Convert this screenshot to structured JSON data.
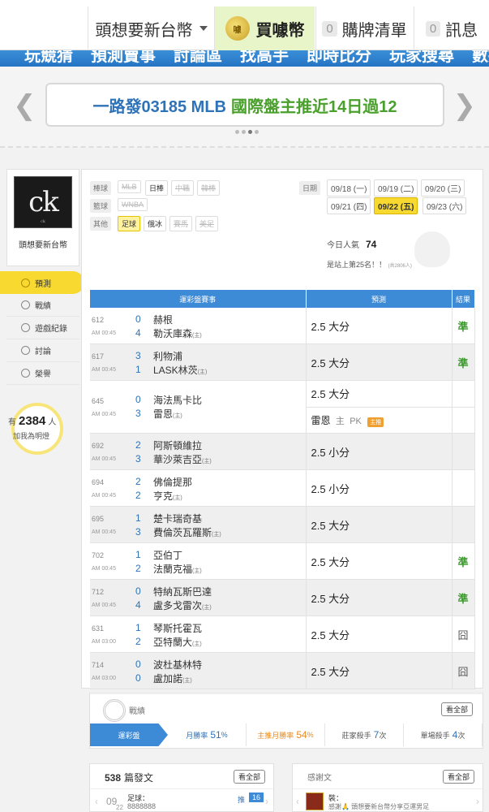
{
  "topbar": {
    "username": "頭想要新台幣",
    "buy_label": "買噱幣",
    "coin_glyph": "噱",
    "bets_count": "0",
    "bets_label": "購牌清單",
    "msg_count": "0",
    "msg_label": "訊息"
  },
  "nav": {
    "items": [
      "玩競猜",
      "預測賣事",
      "討論區",
      "找高手",
      "即時比分",
      "玩家搜尋",
      "數據"
    ]
  },
  "banner": {
    "prefix": "一路發03185 MLB",
    "highlight": "國際盤主推近14日過12",
    "prev_glyph": "❮",
    "next_glyph": "❯"
  },
  "sidebar": {
    "avatar_text": "ck",
    "avatar_sub": "ck",
    "username": "頭想要新台幣",
    "menu": [
      {
        "label": "預測",
        "icon": "target-icon",
        "active": true
      },
      {
        "label": "戰績",
        "icon": "record-icon"
      },
      {
        "label": "遊戲紀錄",
        "icon": "history-icon"
      },
      {
        "label": "討論",
        "icon": "discussion-icon"
      },
      {
        "label": "榮譽",
        "icon": "honor-icon"
      }
    ],
    "fans_prefix": "有",
    "fans_count": "2384",
    "fans_suffix": "人",
    "fans_note": "加我為明燈"
  },
  "filters": {
    "baseball_label": "棒球",
    "basketball_label": "籃球",
    "other_label": "其他",
    "baseball": [
      "MLB",
      "日棒",
      "中職",
      "韓棒"
    ],
    "basketball": [
      "WNBA"
    ],
    "other": [
      "足球",
      "俄冰",
      "賽馬",
      "美足"
    ],
    "date_label": "日期",
    "dates": [
      "09/18 (一)",
      "09/19 (二)",
      "09/20 (三)",
      "09/21 (四)",
      "09/22 (五)",
      "09/23 (六)"
    ],
    "selected_date": "09/22 (五)"
  },
  "stats": {
    "popularity_label": "今日人氣",
    "popularity": "74",
    "rank_text": "是站上第25名！！",
    "rank_note": "(共2806人)"
  },
  "table": {
    "headers": [
      "運彩盤賽事",
      "預測",
      "結果"
    ],
    "host_mark": "(主)",
    "rows": [
      {
        "num": "612",
        "time": "AM 00:45",
        "s1": "0",
        "t1": "赫根",
        "s2": "4",
        "t2": "勒沃庫森",
        "pred": "2.5 大分",
        "result": "準"
      },
      {
        "num": "617",
        "time": "AM 00:45",
        "s1": "3",
        "t1": "利物浦",
        "s2": "1",
        "t2": "LASK林茨",
        "pred": "2.5 大分",
        "result": "準"
      },
      {
        "num": "645",
        "time": "AM 00:45",
        "s1": "0",
        "t1": "海法馬卡比",
        "s2": "3",
        "t2": "雷恩",
        "pred": "2.5 大分",
        "pred2_team": "雷恩",
        "pred2_host": "主",
        "pred2_pk": "PK",
        "pred2_tag": "主推",
        "result": ""
      },
      {
        "num": "692",
        "time": "AM 00:45",
        "s1": "2",
        "t1": "阿斯頓維拉",
        "s2": "3",
        "t2": "華沙萊吉亞",
        "pred": "2.5 小分",
        "result": ""
      },
      {
        "num": "694",
        "time": "AM 00:45",
        "s1": "2",
        "t1": "佛倫提那",
        "s2": "2",
        "t2": "亨克",
        "pred": "2.5 小分",
        "result": ""
      },
      {
        "num": "695",
        "time": "AM 00:45",
        "s1": "1",
        "t1": "楚卡瑞奇基",
        "s2": "3",
        "t2": "費倫茨瓦羅斯",
        "pred": "2.5 大分",
        "result": ""
      },
      {
        "num": "702",
        "time": "AM 00:45",
        "s1": "1",
        "t1": "亞伯丁",
        "s2": "2",
        "t2": "法蘭克福",
        "pred": "2.5 大分",
        "result": "準"
      },
      {
        "num": "712",
        "time": "AM 00:45",
        "s1": "0",
        "t1": "特納瓦斯巴達",
        "s2": "4",
        "t2": "盧多戈雷次",
        "pred": "2.5 大分",
        "result": "準"
      },
      {
        "num": "631",
        "time": "AM 03:00",
        "s1": "1",
        "t1": "琴斯托霍瓦",
        "s2": "2",
        "t2": "亞特蘭大",
        "pred": "2.5 大分",
        "result": "囧"
      },
      {
        "num": "714",
        "time": "AM 03:00",
        "s1": "0",
        "t1": "波杜基林特",
        "s2": "0",
        "t2": "盧加諾",
        "pred": "2.5 大分",
        "result": "囧"
      }
    ]
  },
  "record": {
    "title": "戰績",
    "more": "看全部",
    "tab": "運彩盤",
    "monthly_label": "月勝率",
    "monthly_value": "51",
    "host_label": "主推月勝率",
    "host_value": "54",
    "streak_label": "莊家殺手",
    "streak_value": "7",
    "single_label": "單場殺手",
    "single_value": "4",
    "pct": "%",
    "times": "次"
  },
  "posts": {
    "count": "538",
    "label": "篇發文",
    "more": "看全部",
    "date_month": "09",
    "date_day": "22",
    "sport": "足球：",
    "title": "8888888",
    "push_label": "推",
    "push_count": "16"
  },
  "thanks": {
    "label": "感謝文",
    "more": "看全部",
    "name": "裝：",
    "text": "感謝🙏 頭想要新台幣分享亞運男足"
  }
}
